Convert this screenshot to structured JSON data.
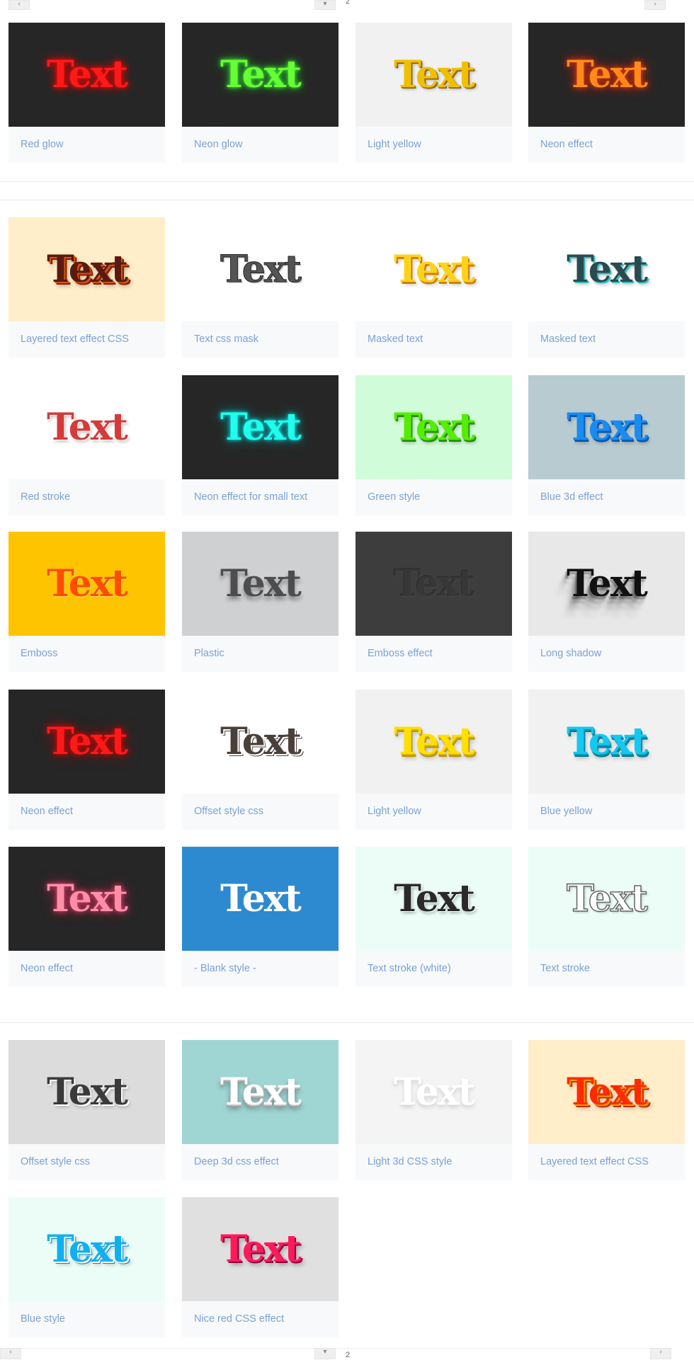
{
  "pagination_top": {
    "prev_icon": "chevron-left-icon",
    "next_icon": "chevron-right-icon",
    "page": "2"
  },
  "pagination_bottom": {
    "prev_icon": "chevron-left-icon",
    "next_icon": "chevron-right-icon",
    "page": "2"
  },
  "sample_text": "Text",
  "colors": {
    "label": "#7aa2d8",
    "card_bg": "#f8f9fa"
  },
  "sections": [
    {
      "cards": [
        {
          "label": "Red glow",
          "bg": "#262626",
          "color": "#ff1a1a",
          "fx": "redglow"
        },
        {
          "label": "Neon glow",
          "bg": "#262626",
          "color": "#66ff33",
          "fx": "neonglow"
        },
        {
          "label": "Light yellow",
          "bg": "#f1f1f1",
          "color": "#f0c000",
          "fx": "lightyellow3d"
        },
        {
          "label": "Neon effect",
          "bg": "#262626",
          "color": "#ff8a1a",
          "fx": "neonorange"
        }
      ]
    },
    {
      "cards": [
        {
          "label": "Layered text effect CSS",
          "bg": "#ffeec9",
          "color": "#5a1a10",
          "fx": "layered"
        },
        {
          "label": "Text css mask",
          "bg": "#ffffff",
          "color": "#555555",
          "fx": "mask"
        },
        {
          "label": "Masked text",
          "bg": "#ffffff",
          "color": "#ffd21a",
          "fx": "maskgold"
        },
        {
          "label": "Masked text",
          "bg": "#ffffff",
          "color": "#2a4a50",
          "fx": "maskteal"
        },
        {
          "label": "Red stroke",
          "bg": "#ffffff",
          "color": "#d43a3a",
          "fx": "redstroke"
        },
        {
          "label": "Neon effect for small text",
          "bg": "#262626",
          "color": "#20ffee",
          "fx": "cyanneon"
        },
        {
          "label": "Green style",
          "bg": "#d0fcd9",
          "color": "#55ee00",
          "fx": "green3d"
        },
        {
          "label": "Blue 3d effect",
          "bg": "#b8cbd0",
          "color": "#1a8cf0",
          "fx": "blue3d"
        },
        {
          "label": "Emboss",
          "bg": "#ffc400",
          "color": "#ff4d00",
          "fx": "emboss"
        },
        {
          "label": "Plastic",
          "bg": "#cfd0d2",
          "color": "#4d4d4d",
          "fx": "plastic"
        },
        {
          "label": "Emboss effect",
          "bg": "#3d3d3d",
          "color": "#373737",
          "fx": "embossdark"
        },
        {
          "label": "Long shadow",
          "bg": "#e8e8e8",
          "color": "#111111",
          "fx": "longshadow"
        },
        {
          "label": "Neon effect",
          "bg": "#262626",
          "color": "#ff1a1a",
          "fx": "redneon"
        },
        {
          "label": "Offset style css",
          "bg": "#ffffff",
          "color": "#4a403a",
          "fx": "offset"
        },
        {
          "label": "Light yellow",
          "bg": "#f1f1f1",
          "color": "#ffe000",
          "fx": "yellow3d"
        },
        {
          "label": "Blue yellow",
          "bg": "#f1f1f1",
          "color": "#14c8f0",
          "fx": "blueyellow"
        },
        {
          "label": "Neon effect",
          "bg": "#262626",
          "color": "#ff8fa8",
          "fx": "pinkneon"
        },
        {
          "label": "- Blank style -",
          "bg": "#2e8ad0",
          "color": "#ffffff",
          "fx": "blank"
        },
        {
          "label": "Text stroke (white)",
          "bg": "#ecfdf7",
          "color": "#2a2a2a",
          "fx": "strokewhite"
        },
        {
          "label": "Text stroke",
          "bg": "#ecfdf7",
          "color": "#ffffff",
          "fx": "strokeoutline"
        }
      ]
    },
    {
      "cards": [
        {
          "label": "Offset style css",
          "bg": "#dcdcdc",
          "color": "#3a3a3a",
          "fx": "offsetgrey"
        },
        {
          "label": "Deep 3d css effect",
          "bg": "#9fd6d4",
          "color": "#ffffff",
          "fx": "deep3d"
        },
        {
          "label": "Light 3d CSS style",
          "bg": "#f4f4f4",
          "color": "#ffffff",
          "fx": "light3d"
        },
        {
          "label": "Layered text effect CSS",
          "bg": "#ffeec9",
          "color": "#ff2a00",
          "fx": "layeredred"
        },
        {
          "label": "Blue style",
          "bg": "#ecfdf7",
          "color": "#10b0f0",
          "fx": "bluestyle"
        },
        {
          "label": "Nice red CSS effect",
          "bg": "#e0e0e0",
          "color": "#ff1a5a",
          "fx": "nicered"
        }
      ]
    }
  ]
}
